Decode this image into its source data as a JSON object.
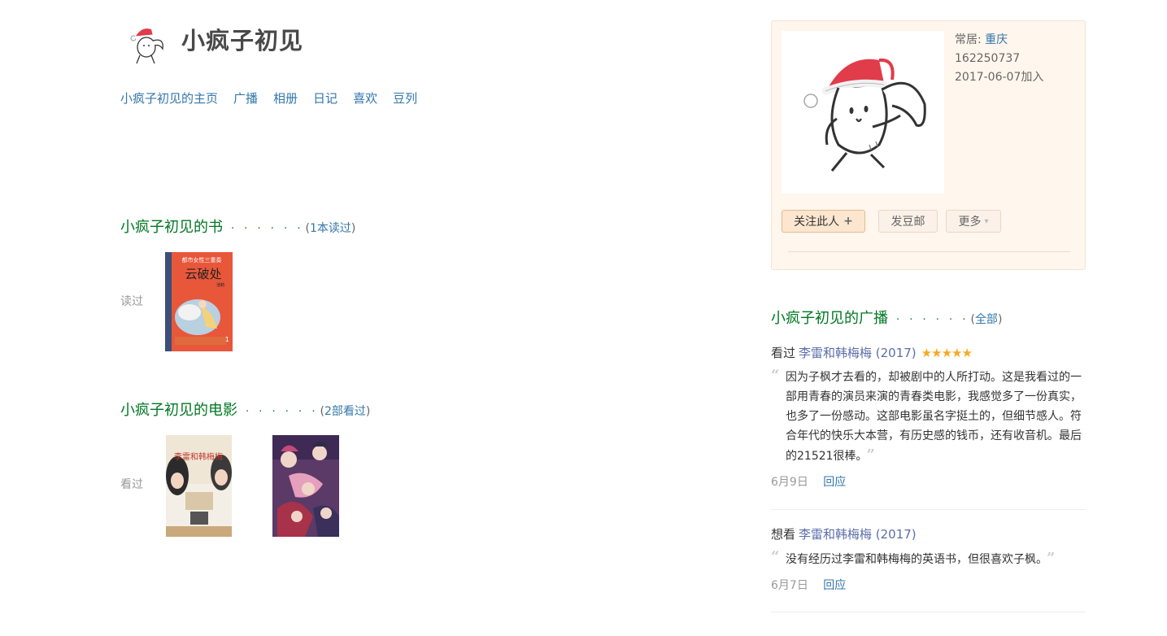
{
  "user": {
    "name": "小疯子初见"
  },
  "nav": {
    "items": [
      {
        "label": "小疯子初见的主页"
      },
      {
        "label": "广播"
      },
      {
        "label": "相册"
      },
      {
        "label": "日记"
      },
      {
        "label": "喜欢"
      },
      {
        "label": "豆列"
      }
    ]
  },
  "books": {
    "title": "小疯子初见的书",
    "dots": "· · · · · ·",
    "paren_open": "(",
    "paren_close": ")",
    "count_link": "1本读过",
    "row_label": "读过",
    "covers": [
      {
        "series": "都市女性三重奏",
        "title": "云破处",
        "author": "池莉"
      }
    ]
  },
  "movies": {
    "title": "小疯子初见的电影",
    "dots": "· · · · · ·",
    "paren_open": "(",
    "paren_close": ")",
    "count_link": "2部看过",
    "row_label": "看过",
    "covers": [
      {
        "title": "李雷和韩梅梅"
      },
      {
        "title": ""
      }
    ]
  },
  "profile": {
    "residence_label": "常居:",
    "residence_city": "重庆",
    "user_id": "162250737",
    "joined": "2017-06-07加入",
    "follow_button": "关注此人",
    "follow_icon": "+",
    "mail_button": "发豆邮",
    "more_button": "更多",
    "more_icon": "▾"
  },
  "broadcasts": {
    "title": "小疯子初见的广播",
    "dots": "· · · · · ·",
    "paren_open": "(",
    "paren_close": ")",
    "all_link": "全部",
    "items": [
      {
        "action": "看过",
        "subject": "李雷和韩梅梅 (2017)",
        "rating": 5,
        "stars": "★★★★★",
        "comment": "因为子枫才去看的，却被剧中的人所打动。这是我看过的一部用青春的演员来演的青春类电影，我感觉多了一份真实，也多了一份感动。这部电影虽名字挺土的，但细节感人。符合年代的快乐大本营，有历史感的钱币，还有收音机。最后的21521很棒。",
        "date": "6月9日",
        "reply": "回应"
      },
      {
        "action": "想看",
        "subject": "李雷和韩梅梅 (2017)",
        "comment": "没有经历过李雷和韩梅梅的英语书，但很喜欢子枫。",
        "date": "6月7日",
        "reply": "回应"
      }
    ]
  },
  "colors": {
    "link": "#3377aa",
    "section_green": "#007722",
    "card_bg": "#fff6ed",
    "star": "#f9a825"
  }
}
